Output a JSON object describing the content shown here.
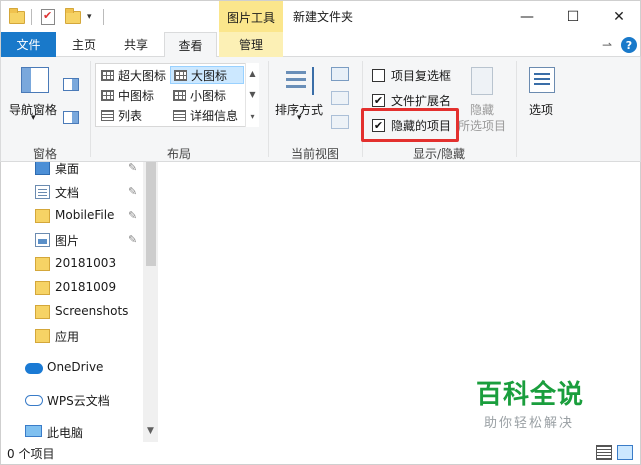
{
  "window": {
    "title": "新建文件夹",
    "context_tab_group": "图片工具",
    "controls": {
      "minimize": "—",
      "maximize": "☐",
      "close": "✕"
    }
  },
  "tabs": {
    "file": "文件",
    "home": "主页",
    "share": "共享",
    "view": "查看",
    "manage": "管理",
    "active": "查看"
  },
  "ribbon": {
    "panes": {
      "nav_pane": "导航窗格",
      "group": "窗格"
    },
    "layout": {
      "group": "布局",
      "items": [
        "超大图标",
        "大图标",
        "中图标",
        "小图标",
        "列表",
        "详细信息"
      ],
      "selected": "大图标"
    },
    "current_view": {
      "sort_by": "排序方式",
      "group": "当前视图"
    },
    "show_hide": {
      "group": "显示/隐藏",
      "item_checkboxes": {
        "label": "项目复选框",
        "checked": false
      },
      "file_extensions": {
        "label": "文件扩展名",
        "checked": true
      },
      "hidden_items": {
        "label": "隐藏的项目",
        "checked": true
      },
      "hide_selected_line1": "隐藏",
      "hide_selected_line2": "所选项目"
    },
    "options": "选项"
  },
  "nav": {
    "items": [
      {
        "label": "桌面",
        "icon": "desktop-icon",
        "pinned": true
      },
      {
        "label": "文档",
        "icon": "document-icon",
        "pinned": true
      },
      {
        "label": "MobileFile",
        "icon": "folder-icon",
        "pinned": true
      },
      {
        "label": "图片",
        "icon": "pictures-icon",
        "pinned": true
      },
      {
        "label": "20181003",
        "icon": "folder-icon",
        "pinned": false
      },
      {
        "label": "20181009",
        "icon": "folder-icon",
        "pinned": false
      },
      {
        "label": "Screenshots",
        "icon": "folder-icon",
        "pinned": false
      },
      {
        "label": "应用",
        "icon": "folder-icon",
        "pinned": false
      }
    ],
    "onedrive": "OneDrive",
    "wps": "WPS云文档",
    "this_pc": "此电脑"
  },
  "status": {
    "item_count": "0 个项目"
  },
  "watermark": {
    "title": "百科全说",
    "subtitle": "助你轻松解决"
  },
  "colors": {
    "accent": "#1979ca",
    "context_tab": "#fbe68c",
    "highlight": "#e3302e",
    "watermark": "#1a9e3d"
  }
}
